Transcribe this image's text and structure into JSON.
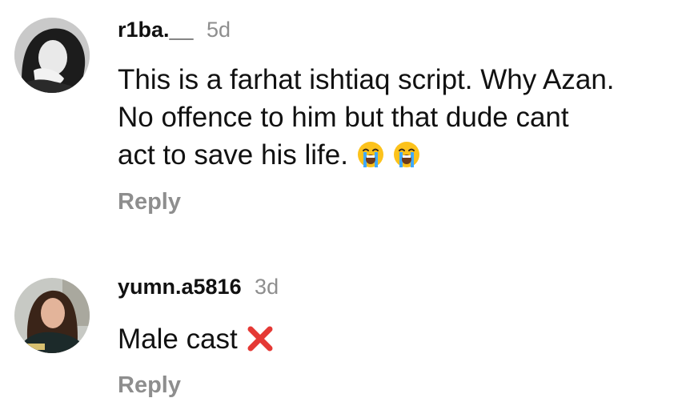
{
  "comments": [
    {
      "username": "r1ba.__",
      "time": "5d",
      "text_lines": [
        "This is a farhat ishtiaq script. Why Azan.",
        "No offence to him but that dude cant",
        "act to save his life."
      ],
      "trailing_emoji": [
        "loudly-crying-face",
        "loudly-crying-face"
      ],
      "reply_label": "Reply"
    },
    {
      "username": "yumn.a5816",
      "time": "3d",
      "text": "Male cast",
      "trailing_emoji": [
        "cross-mark"
      ],
      "reply_label": "Reply"
    }
  ],
  "colors": {
    "username": "#111111",
    "timestamp": "#8e8e8e",
    "reply": "#8e8e8e",
    "cross_mark": "#e53935"
  }
}
